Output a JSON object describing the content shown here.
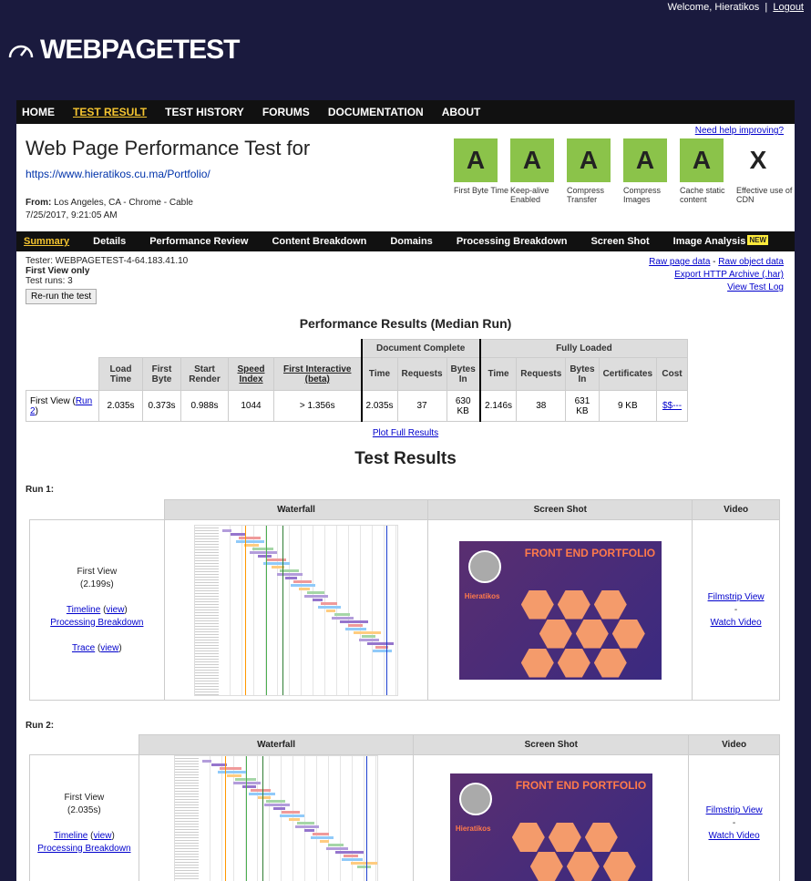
{
  "header": {
    "welcome": "Welcome, Hieratikos",
    "separator": "|",
    "logout": "Logout",
    "logo": "WEBPAGETEST"
  },
  "nav": [
    "HOME",
    "TEST RESULT",
    "TEST HISTORY",
    "FORUMS",
    "DOCUMENTATION",
    "ABOUT"
  ],
  "nav_active": "TEST RESULT",
  "page": {
    "title": "Web Page Performance Test for",
    "url": "https://www.hieratikos.cu.ma/Portfolio/",
    "from_label": "From:",
    "from_value": "Los Angeles, CA - Chrome - Cable",
    "date": "7/25/2017, 9:21:05 AM",
    "help": "Need help improving?"
  },
  "grades": [
    {
      "grade": "A",
      "label": "First Byte Time"
    },
    {
      "grade": "A",
      "label": "Keep-alive Enabled"
    },
    {
      "grade": "A",
      "label": "Compress Transfer"
    },
    {
      "grade": "A",
      "label": "Compress Images"
    },
    {
      "grade": "A",
      "label": "Cache static content"
    },
    {
      "grade": "X",
      "label": "Effective use of CDN"
    }
  ],
  "subnav": [
    "Summary",
    "Details",
    "Performance Review",
    "Content Breakdown",
    "Domains",
    "Processing Breakdown",
    "Screen Shot",
    "Image Analysis"
  ],
  "subnav_badge": "NEW",
  "tester": {
    "tester": "Tester: WEBPAGETEST-4-64.183.41.10",
    "view": "First View only",
    "runs": "Test runs: 3",
    "rerun": "Re-run the test"
  },
  "raw_links": {
    "raw_page": "Raw page data",
    "dash": " - ",
    "raw_object": "Raw object data",
    "export": "Export HTTP Archive (.har)",
    "log": "View Test Log"
  },
  "perf": {
    "title": "Performance Results (Median Run)",
    "group_doc": "Document Complete",
    "group_full": "Fully Loaded",
    "headers": [
      "Load Time",
      "First Byte",
      "Start Render",
      "Speed Index",
      "First Interactive (beta)",
      "Time",
      "Requests",
      "Bytes In",
      "Time",
      "Requests",
      "Bytes In",
      "Certificates",
      "Cost"
    ],
    "row_label": "First View (",
    "row_link": "Run 2",
    "row_close": ")",
    "values": [
      "2.035s",
      "0.373s",
      "0.988s",
      "1044",
      "> 1.356s",
      "2.035s",
      "37",
      "630 KB",
      "2.146s",
      "38",
      "631 KB",
      "9 KB",
      "$$---"
    ],
    "plot": "Plot Full Results"
  },
  "test_results": {
    "title": "Test Results",
    "col_waterfall": "Waterfall",
    "col_screenshot": "Screen Shot",
    "col_video": "Video",
    "runs": [
      {
        "label": "Run 1:",
        "view": "First View",
        "time": "(2.199s)",
        "timeline": "Timeline",
        "view_link": "view",
        "processing": "Processing Breakdown",
        "trace": "Trace",
        "filmstrip": "Filmstrip View",
        "dash": "-",
        "watch": "Watch Video"
      },
      {
        "label": "Run 2:",
        "view": "First View",
        "time": "(2.035s)",
        "timeline": "Timeline",
        "view_link": "view",
        "processing": "Processing Breakdown",
        "filmstrip": "Filmstrip View",
        "dash": "-",
        "watch": "Watch Video"
      }
    ]
  },
  "screenshot": {
    "title": "FRONT END PORTFOLIO",
    "name": "Hieratikos"
  },
  "colors": {
    "bg": "#1a1a3e",
    "grade_green": "#8bc34a",
    "active_nav": "#f5c530"
  }
}
